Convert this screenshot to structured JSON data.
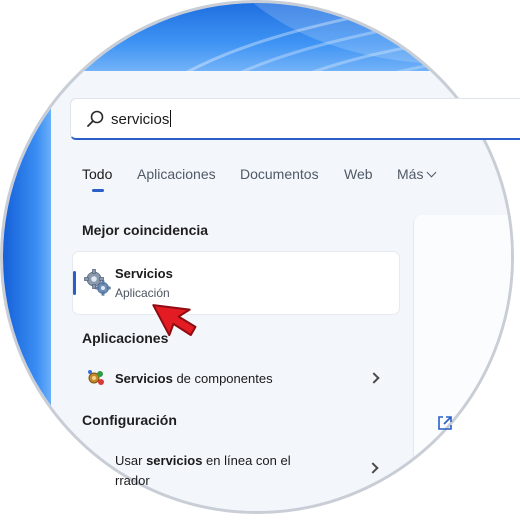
{
  "search": {
    "query": "servicios"
  },
  "tabs": [
    {
      "label": "Todo"
    },
    {
      "label": "Aplicaciones"
    },
    {
      "label": "Documentos"
    },
    {
      "label": "Web"
    },
    {
      "label": "Más"
    }
  ],
  "best_match": {
    "heading": "Mejor coincidencia",
    "title": "Servicios",
    "subtitle": "Aplicación"
  },
  "apps": {
    "heading": "Aplicaciones",
    "item_bold": "Servicios",
    "item_rest": " de componentes"
  },
  "settings": {
    "heading": "Configuración",
    "line1_pre": "Usar ",
    "line1_bold": "servicios",
    "line1_post": " en línea con el",
    "line2": "rrador"
  },
  "colors": {
    "accent": "#2a5fc9",
    "pointer": "#e31b23"
  }
}
